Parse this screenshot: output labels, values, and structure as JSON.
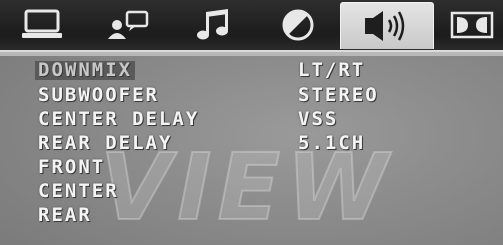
{
  "tabs": [
    {
      "icon": "monitor-icon",
      "active": false
    },
    {
      "icon": "person-display-icon",
      "active": false
    },
    {
      "icon": "music-notes-icon",
      "active": false
    },
    {
      "icon": "contrast-circle-icon",
      "active": false
    },
    {
      "icon": "speaker-audio-icon",
      "active": true
    },
    {
      "icon": "dolby-icon",
      "active": false
    }
  ],
  "watermark": "VIEW",
  "menu": {
    "items": [
      {
        "label": "DOWNMIX",
        "value": "LT/RT",
        "selected": true
      },
      {
        "label": "SUBWOOFER",
        "value": "STEREO"
      },
      {
        "label": "CENTER DELAY",
        "value": "VSS"
      },
      {
        "label": "REAR DELAY",
        "value": "5.1CH"
      },
      {
        "label": "FRONT",
        "value": ""
      },
      {
        "label": "CENTER",
        "value": ""
      },
      {
        "label": "REAR",
        "value": ""
      }
    ]
  },
  "colors": {
    "tabbar": "#1c1c1c",
    "active_tab": "#d6d6d6",
    "text": "#f4f4f4"
  }
}
